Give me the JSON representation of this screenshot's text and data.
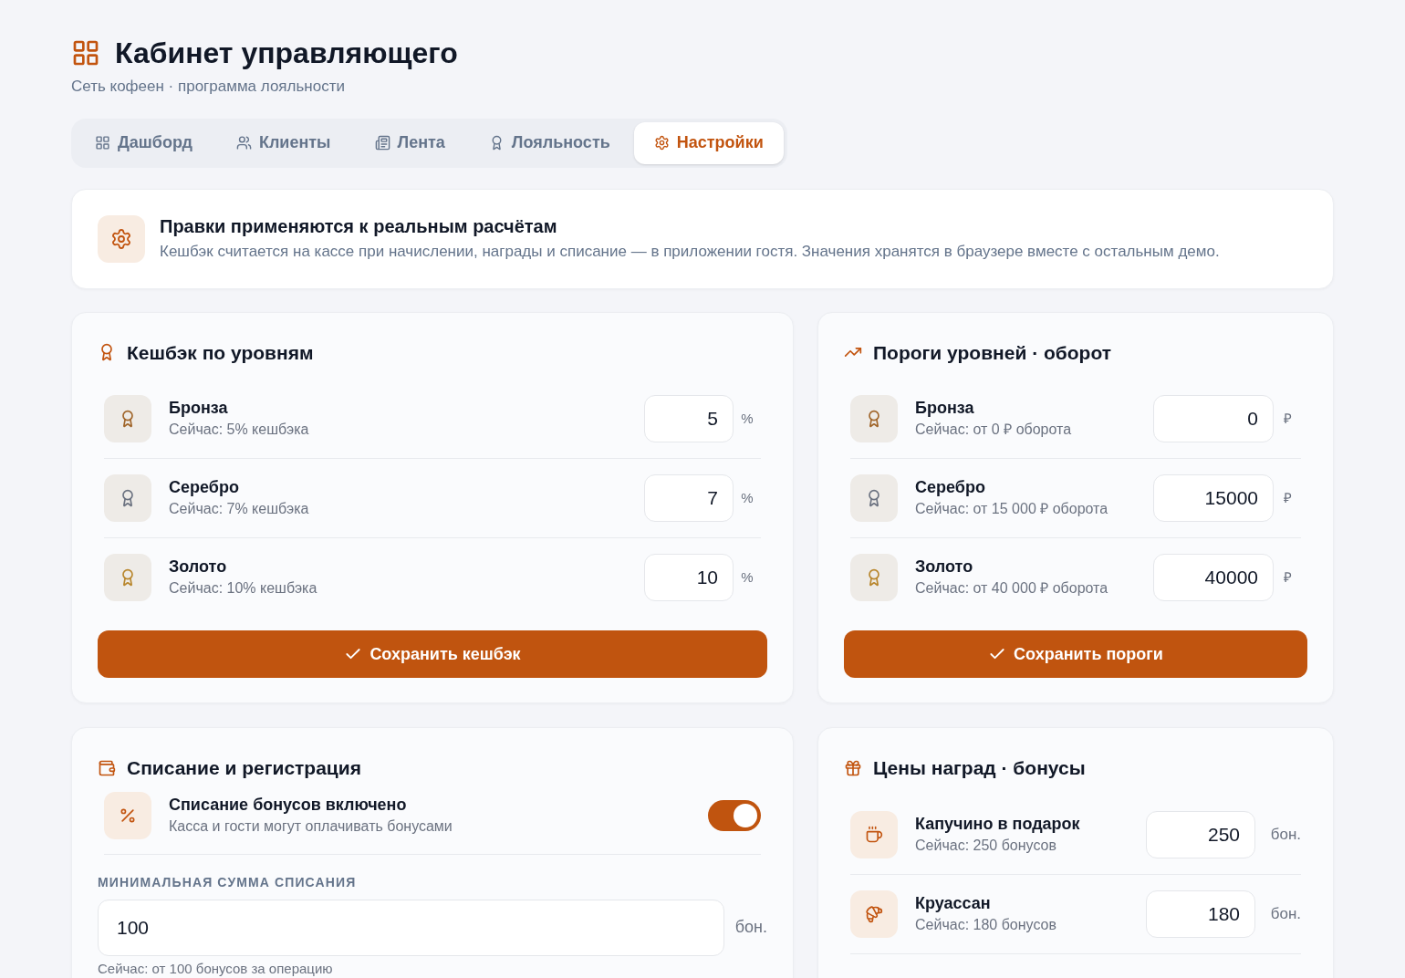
{
  "header": {
    "title": "Кабинет управляющего",
    "subtitle": "Сеть кофеен · программа лояльности"
  },
  "tabs": [
    {
      "label": "Дашборд",
      "kind": "grid",
      "selected": false
    },
    {
      "label": "Клиенты",
      "kind": "users",
      "selected": false
    },
    {
      "label": "Лента",
      "kind": "news",
      "selected": false
    },
    {
      "label": "Лояльность",
      "kind": "award",
      "selected": false
    },
    {
      "label": "Настройки",
      "kind": "settings",
      "selected": true
    }
  ],
  "notice": {
    "title": "Правки применяются к реальным расчётам",
    "text": "Кешбэк считается на кассе при начислении, награды и списание — в приложении гостя. Значения хранятся в браузере вместе с остальным демо."
  },
  "cashback": {
    "title": "Кешбэк по уровням",
    "rows": [
      {
        "name": "Бронза",
        "hint": "Сейчас: 5% кешбэка",
        "value": "5",
        "unit": "%",
        "color": "#a0652a"
      },
      {
        "name": "Серебро",
        "hint": "Сейчас: 7% кешбэка",
        "value": "7",
        "unit": "%",
        "color": "#6b7280"
      },
      {
        "name": "Золото",
        "hint": "Сейчас: 10% кешбэка",
        "value": "10",
        "unit": "%",
        "color": "#b8862c"
      }
    ],
    "button": "Сохранить кешбэк"
  },
  "thresholds": {
    "title": "Пороги уровней · оборот",
    "rows": [
      {
        "name": "Бронза",
        "hint": "Сейчас: от 0 ₽ оборота",
        "value": "0",
        "unit": "₽",
        "color": "#a0652a"
      },
      {
        "name": "Серебро",
        "hint": "Сейчас: от 15 000 ₽ оборота",
        "value": "15000",
        "unit": "₽",
        "color": "#6b7280"
      },
      {
        "name": "Золото",
        "hint": "Сейчас: от 40 000 ₽ оборота",
        "value": "40000",
        "unit": "₽",
        "color": "#b8862c"
      }
    ],
    "button": "Сохранить пороги"
  },
  "redemption": {
    "title": "Списание и регистрация",
    "toggle": {
      "title": "Списание бонусов включено",
      "text": "Касса и гости могут оплачивать бонусами",
      "on": true
    },
    "min_label": "МИНИМАЛЬНАЯ СУММА СПИСАНИЯ",
    "min_value": "100",
    "min_unit": "бон.",
    "min_hint": "Сейчас: от 100 бонусов за операцию"
  },
  "rewards": {
    "title": "Цены наград · бонусы",
    "rows": [
      {
        "name": "Капучино в подарок",
        "hint": "Сейчас: 250 бонусов",
        "value": "250",
        "unit": "бон.",
        "kind": "coffee"
      },
      {
        "name": "Круассан",
        "hint": "Сейчас: 180 бонусов",
        "value": "180",
        "unit": "бон.",
        "kind": "croissant"
      }
    ]
  }
}
